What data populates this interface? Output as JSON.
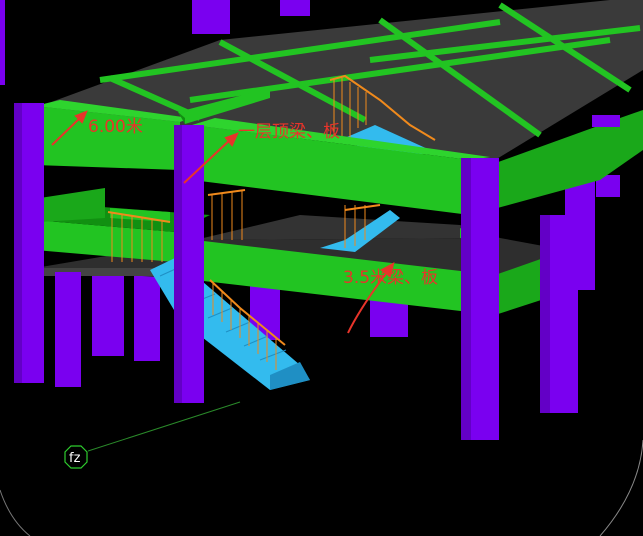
{
  "annotations": {
    "height_600": "6.00米",
    "first_floor_top": "一层顶梁、板",
    "beam_35": "3.5米梁、板"
  },
  "axis_marker": {
    "label": "fz"
  },
  "colors": {
    "background": "#000000",
    "column": "#7a00f0",
    "column_shade": "#5a00b8",
    "beam": "#22c422",
    "beam_shade": "#119011",
    "slab": "#2c2c2c",
    "stair": "#33bbee",
    "railing": "#f08a1c",
    "annotation": "#e8342a"
  }
}
